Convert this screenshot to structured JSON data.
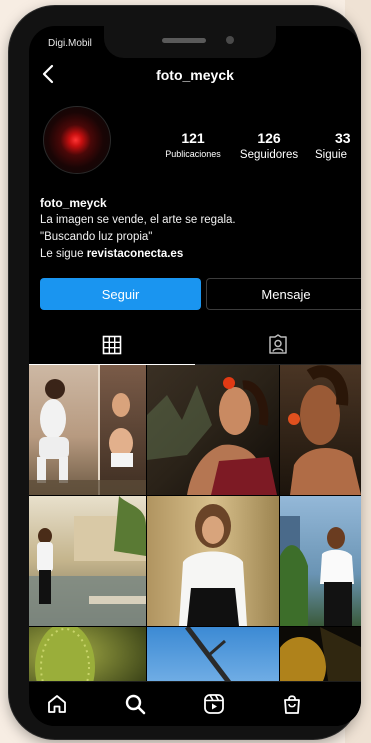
{
  "status_bar": {
    "carrier": "Digi.Mobil"
  },
  "header": {
    "username": "foto_meyck",
    "back_icon": "chevron-left-icon"
  },
  "profile": {
    "avatar_description": "red light avatar",
    "stats": [
      {
        "value": "121",
        "label": "Publicaciones"
      },
      {
        "value": "126",
        "label": "Seguidores"
      },
      {
        "value": "33",
        "label": "Siguie"
      }
    ],
    "name": "foto_meyck",
    "bio_lines": [
      "La imagen se vende, el arte se regala.",
      "\"Buscando luz propia\""
    ],
    "followed_by_prefix": "Le sigue",
    "followed_by_account": "revistaconecta.es"
  },
  "actions": {
    "follow_label": "Seguir",
    "message_label": "Mensaje"
  },
  "tabs": [
    {
      "name": "posts-grid",
      "icon": "grid-icon",
      "active": true
    },
    {
      "name": "tagged",
      "icon": "tagged-person-icon",
      "active": false
    }
  ],
  "nav": [
    {
      "name": "home",
      "icon": "home-icon"
    },
    {
      "name": "search",
      "icon": "search-icon"
    },
    {
      "name": "reels",
      "icon": "reels-icon"
    },
    {
      "name": "shop",
      "icon": "shop-bag-icon"
    }
  ],
  "colors": {
    "accent": "#1a95f0",
    "background": "#000000",
    "text": "#ffffff",
    "avatar_glow": "#e01b1b"
  }
}
